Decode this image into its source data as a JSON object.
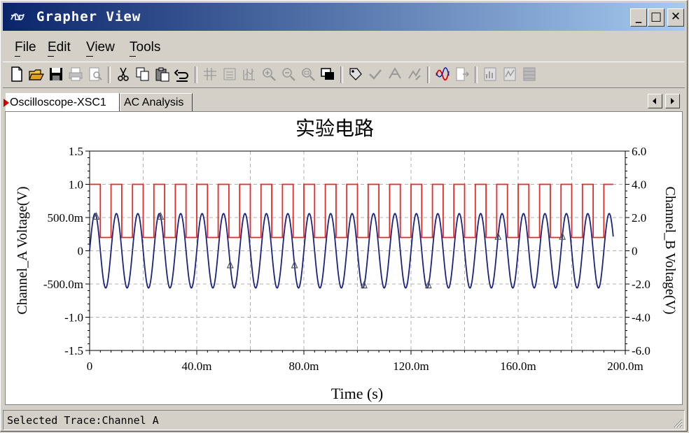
{
  "window": {
    "title": "Grapher View",
    "minimize_label": "_",
    "maximize_label": "□",
    "close_label": "✕"
  },
  "menu": {
    "file": {
      "label": "File",
      "mnemonic": "F"
    },
    "edit": {
      "label": "Edit",
      "mnemonic": "E"
    },
    "view": {
      "label": "View",
      "mnemonic": "V"
    },
    "tools": {
      "label": "Tools",
      "mnemonic": "T"
    }
  },
  "toolbar": {
    "icons": [
      "new-file-icon",
      "open-folder-icon",
      "save-icon",
      "print-icon",
      "print-preview-icon",
      "cut-icon",
      "copy-icon",
      "paste-icon",
      "undo-icon",
      "grid-toggle-icon",
      "legend-toggle-icon",
      "cursors-toggle-icon",
      "zoom-in-icon",
      "zoom-out-icon",
      "zoom-full-icon",
      "reverse-colors-icon",
      "properties-icon",
      "select-marks-icon",
      "add-text-icon",
      "overlay-traces-icon",
      "export-excel-icon",
      "export-measurement-icon",
      "bar-chart-icon",
      "waveform-icon",
      "grayscale-icon"
    ]
  },
  "tabs": [
    {
      "label": "Oscilloscope-XSC1",
      "active": true
    },
    {
      "label": "AC Analysis",
      "active": false
    }
  ],
  "status": {
    "text": "Selected Trace:Channel A"
  },
  "colors": {
    "channel_a": "#1a237e",
    "channel_b": "#e52a2a",
    "grid": "#b0b0b0",
    "title_bar_start": "#0a246a",
    "title_bar_end": "#a6caf0"
  },
  "chart_data": {
    "type": "line",
    "title": "实验电路",
    "xlabel": "Time (s)",
    "ylabel": "Channel_A Voltage(V)",
    "y2label": "Channel_B Voltage(V)",
    "grid": true,
    "xlim": [
      0,
      0.2
    ],
    "ylim": [
      -1.5,
      1.5
    ],
    "y2lim": [
      -6.0,
      6.0
    ],
    "x_ticks": [
      {
        "value": 0,
        "label": "0"
      },
      {
        "value": 0.04,
        "label": "40.0m"
      },
      {
        "value": 0.08,
        "label": "80.0m"
      },
      {
        "value": 0.12,
        "label": "120.0m"
      },
      {
        "value": 0.16,
        "label": "160.0m"
      },
      {
        "value": 0.2,
        "label": "200.0m"
      }
    ],
    "y_ticks": [
      {
        "value": 1.5,
        "label": "1.5"
      },
      {
        "value": 1.0,
        "label": "1.0"
      },
      {
        "value": 0.5,
        "label": "500.0m"
      },
      {
        "value": 0,
        "label": "0"
      },
      {
        "value": -0.5,
        "label": "-500.0m"
      },
      {
        "value": -1.0,
        "label": "-1.0"
      },
      {
        "value": -1.5,
        "label": "-1.5"
      }
    ],
    "y2_ticks": [
      {
        "value": 6.0,
        "label": "6.0"
      },
      {
        "value": 4.0,
        "label": "4.0"
      },
      {
        "value": 2.0,
        "label": "2.0"
      },
      {
        "value": 0,
        "label": "0"
      },
      {
        "value": -2.0,
        "label": "-2.0"
      },
      {
        "value": -4.0,
        "label": "-4.0"
      },
      {
        "value": -6.0,
        "label": "-6.0"
      }
    ],
    "series": [
      {
        "name": "Channel A",
        "axis": "left",
        "kind": "sine",
        "amplitude": 0.56,
        "period": 0.008,
        "phase": 0,
        "t_start": 0,
        "t_end": 0.1955,
        "marker_times": [
          0.0025,
          0.0265,
          0.0525,
          0.0765,
          0.1025,
          0.1265,
          0.1525,
          0.1765
        ]
      },
      {
        "name": "Channel B",
        "axis": "right",
        "kind": "square",
        "high": 4.0,
        "low": 0.8,
        "period": 0.008,
        "duty": 0.5,
        "t_start": 0,
        "t_end": 0.1955
      }
    ]
  }
}
